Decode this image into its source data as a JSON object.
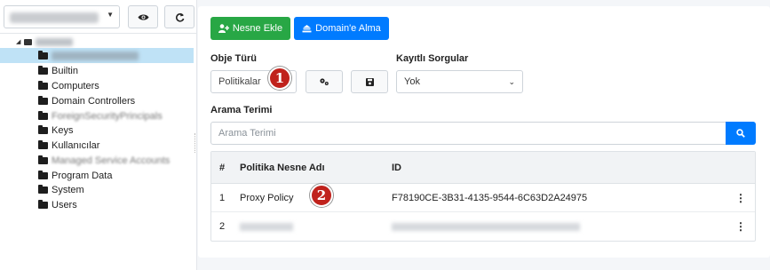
{
  "sidebar": {
    "domain_value": "redacted",
    "tree": {
      "root_label": "redacted",
      "items": [
        {
          "label": "redacted",
          "selected": true,
          "redacted": true
        },
        {
          "label": "Builtin"
        },
        {
          "label": "Computers"
        },
        {
          "label": "Domain Controllers"
        },
        {
          "label": "ForeignSecurityPrincipals",
          "redacted": true
        },
        {
          "label": "Keys"
        },
        {
          "label": "Kullanıcılar"
        },
        {
          "label": "Managed Service Accounts",
          "redacted": true
        },
        {
          "label": "Program Data"
        },
        {
          "label": "System"
        },
        {
          "label": "Users"
        }
      ]
    },
    "icons": {
      "eye": "eye-icon",
      "refresh": "refresh-icon"
    }
  },
  "toolbar": {
    "add_object_label": "Nesne Ekle",
    "domain_join_label": "Domain'e Alma"
  },
  "form": {
    "object_type_label": "Obje Türü",
    "object_type_value": "Politikalar",
    "saved_queries_label": "Kayıtlı Sorgular",
    "saved_queries_value": "Yok",
    "search_label": "Arama Terimi",
    "search_placeholder": "Arama Terimi"
  },
  "table": {
    "headers": {
      "num": "#",
      "name": "Politika Nesne Adı",
      "id": "ID"
    },
    "rows": [
      {
        "num": "1",
        "name": "Proxy Policy",
        "id": "F78190CE-3B31-4135-9544-6C63D2A24975",
        "menu": "⋮"
      },
      {
        "num": "2",
        "name": "redacted",
        "id": "redacted",
        "menu": "⋮"
      }
    ]
  },
  "annotations": {
    "badge1": "1",
    "badge2": "2"
  },
  "colors": {
    "green": "#28a745",
    "blue": "#007bff",
    "selected": "#bfe2f6",
    "badge": "#c0221c"
  }
}
